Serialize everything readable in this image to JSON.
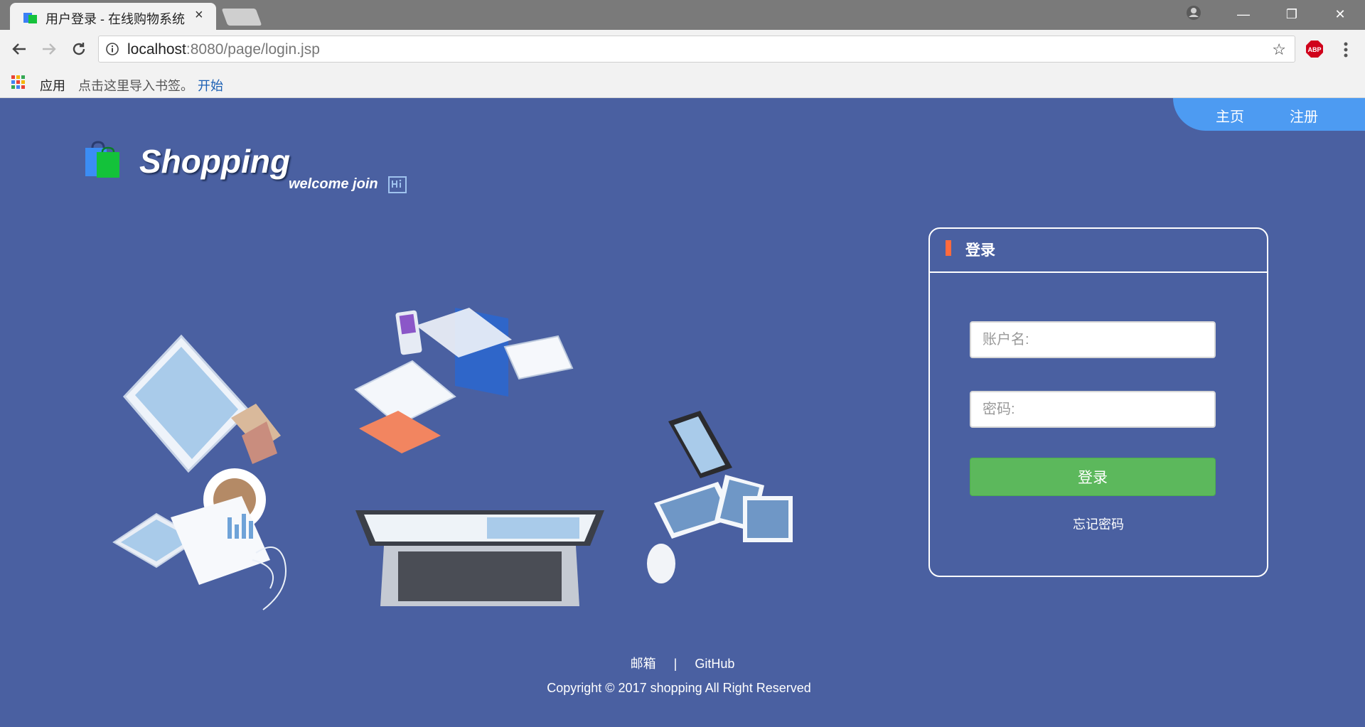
{
  "browser": {
    "tab_title": "用户登录 - 在线购物系统",
    "tab_close": "×",
    "url_host": "localhost",
    "url_path": ":8080/page/login.jsp",
    "bookmarks": {
      "apps_label": "应用",
      "hint": "点击这里导入书签。",
      "start_link": "开始"
    },
    "window_controls": {
      "minimize": "—",
      "restore": "❐",
      "close": "✕"
    }
  },
  "nav": {
    "home": "主页",
    "register": "注册"
  },
  "brand": {
    "name": "Shopping",
    "tagline": "welcome join"
  },
  "login": {
    "title": "登录",
    "username_placeholder": "账户名:",
    "password_placeholder": "密码:",
    "submit_label": "登录",
    "forgot_label": "忘记密码"
  },
  "footer": {
    "email_label": "邮箱",
    "separator": "|",
    "github_label": "GitHub",
    "copyright": "Copyright © 2017 shopping All Right Reserved"
  },
  "colors": {
    "page_bg": "#4a60a1",
    "nav_bg": "#4d9bf2",
    "login_button": "#5cb85c",
    "title_marker": "#ff6a3d"
  }
}
